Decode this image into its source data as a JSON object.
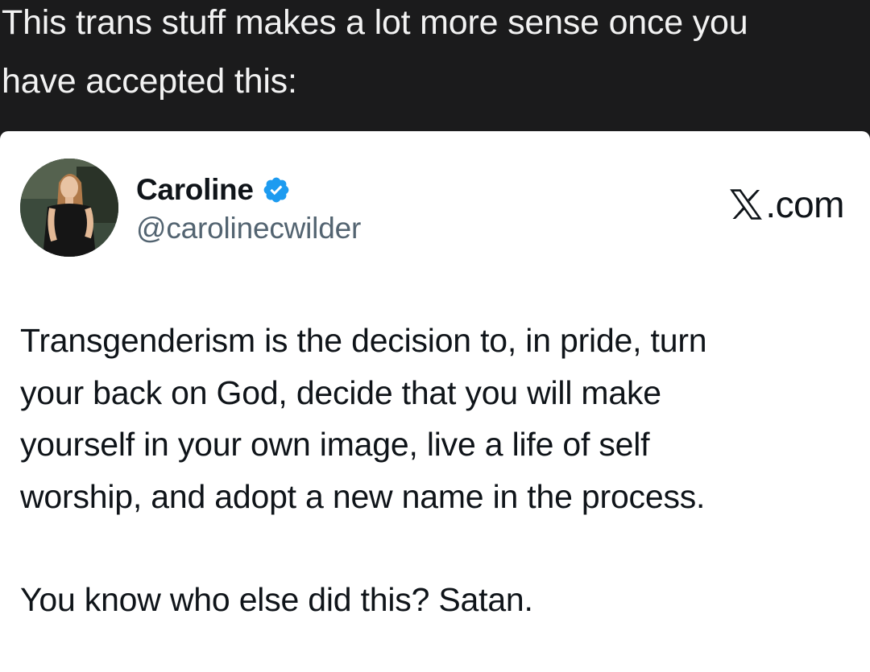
{
  "caption": {
    "line1": "This trans stuff makes a lot more sense once you",
    "line2": "have accepted this:"
  },
  "tweet": {
    "author": {
      "display_name": "Caroline",
      "handle": "@carolinecwilder",
      "verified_icon": "verified-badge-icon",
      "verified_color": "#1d9bf0"
    },
    "brand": {
      "icon": "x-logo-icon",
      "text": ".com"
    },
    "body": {
      "line1": "Transgenderism is the decision to, in pride, turn",
      "line2": "your back on God, decide that you will make",
      "line3": "yourself in your own image, live a life of self",
      "line4": "worship, and adopt a new name in the process.",
      "paragraph2": "You know who else did this? Satan."
    }
  },
  "colors": {
    "background": "#1b1b1c",
    "caption_text": "#f2f2f2",
    "card": "#ffffff",
    "text_primary": "#0f1419",
    "text_secondary": "#536471"
  }
}
